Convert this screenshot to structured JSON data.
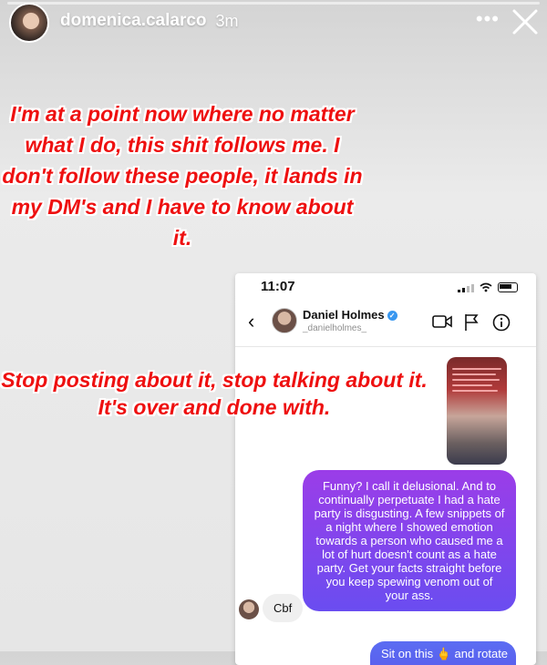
{
  "story": {
    "username": "domenica.calarco",
    "time_ago": "3m",
    "more_label": "•••",
    "caption_top": "I'm at a point now where no matter what I do, this shit follows me. I don't follow these people, it lands in my DM's and I have to know about it.",
    "caption_bottom": "Stop posting about it, stop talking about it. It's over and done with."
  },
  "screenshot": {
    "status_time": "11:07",
    "contact_name": "Daniel Holmes",
    "contact_handle": "_danielholmes_",
    "back_label": "‹",
    "messages": [
      {
        "from": "me",
        "text": "Funny? I call it delusional. And to continually perpetuate I had a hate party is disgusting. A few snippets of a night where I showed emotion towards a person who caused me a lot of hurt doesn't count as a hate party. Get your facts straight before you keep spewing venom out of your ass."
      },
      {
        "from": "them",
        "text": "Cbf"
      },
      {
        "from": "me",
        "text": "Sit on this 🖕 and rotate"
      }
    ]
  },
  "colors": {
    "caption_red": "#ee1010",
    "bubble_purple": "#8a45ec",
    "verified_blue": "#3897f0"
  }
}
